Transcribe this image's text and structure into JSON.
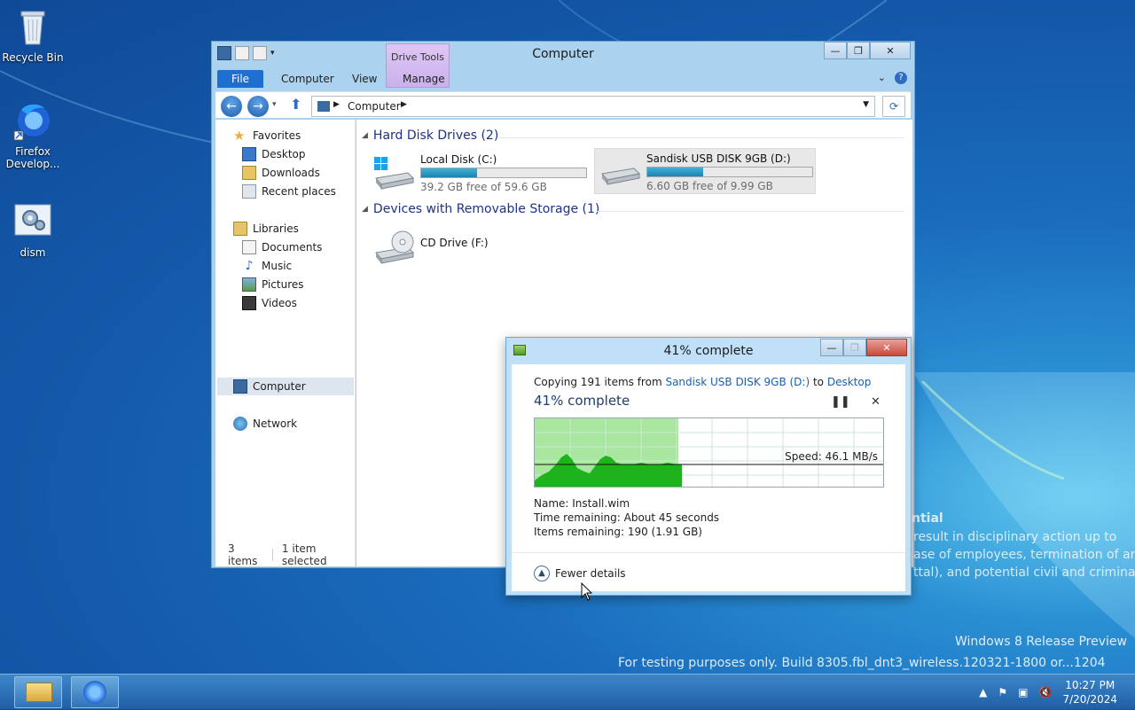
{
  "desktop": {
    "icons": [
      {
        "label": "Recycle Bin",
        "icon": "recycle-bin-icon"
      },
      {
        "label": "Firefox Develop...",
        "icon": "firefox-developer-icon"
      },
      {
        "label": "dism",
        "icon": "settings-gear-icon"
      }
    ]
  },
  "explorer": {
    "title": "Computer",
    "ribbon": {
      "file_tab": "File",
      "tabs": [
        "Computer",
        "View"
      ],
      "contextual_group": "Drive Tools",
      "contextual_tab": "Manage"
    },
    "address": {
      "path": "Computer"
    },
    "nav": {
      "favorites": "Favorites",
      "favorites_items": [
        "Desktop",
        "Downloads",
        "Recent places"
      ],
      "libraries": "Libraries",
      "libraries_items": [
        "Documents",
        "Music",
        "Pictures",
        "Videos"
      ],
      "computer": "Computer",
      "network": "Network"
    },
    "groups": {
      "hard_disks": "Hard Disk Drives (2)",
      "removable": "Devices with Removable Storage (1)"
    },
    "drives": [
      {
        "name": "Local Disk (C:)",
        "free": "39.2 GB free of 59.6 GB",
        "used_fraction": 0.34,
        "selected": false
      },
      {
        "name": "Sandisk USB DISK 9GB (D:)",
        "free": "6.60 GB free of 9.99 GB",
        "used_fraction": 0.34,
        "selected": true
      },
      {
        "name": "CD Drive (F:)"
      }
    ],
    "status": {
      "items": "3 items",
      "selected": "1 item selected"
    }
  },
  "copy_dialog": {
    "title": "41% complete",
    "copy_prefix": "Copying 191 items from ",
    "source": "Sandisk USB DISK 9GB (D:)",
    "to_word": " to ",
    "destination": "Desktop",
    "percent_text": "41% complete",
    "progress_fraction": 0.41,
    "speed": "Speed: 46.1 MB/s",
    "name_line": "Name:  Install.wim",
    "time_line": "Time remaining:  About 45 seconds",
    "items_line": "Items remaining:  190 (1.91 GB)",
    "fewer_details": "Fewer details"
  },
  "watermark": {
    "legal_1": "ntial",
    "legal_2": "result in disciplinary action up to",
    "legal_3": "ase of employees, termination of an",
    "legal_4": "ttal), and potential civil and criminal",
    "edition": "Windows 8 Release Preview",
    "build": "For testing purposes only. Build 8305.fbl_dnt3_wireless.120321-1800 or...1204"
  },
  "taskbar": {
    "time": "10:27 PM",
    "date": "7/20/2024"
  },
  "colors": {
    "accent": "#1e6fd0",
    "link": "#1a5fb4",
    "graph_fill": "#1db31d",
    "drive_bar": "#26a0c8"
  }
}
